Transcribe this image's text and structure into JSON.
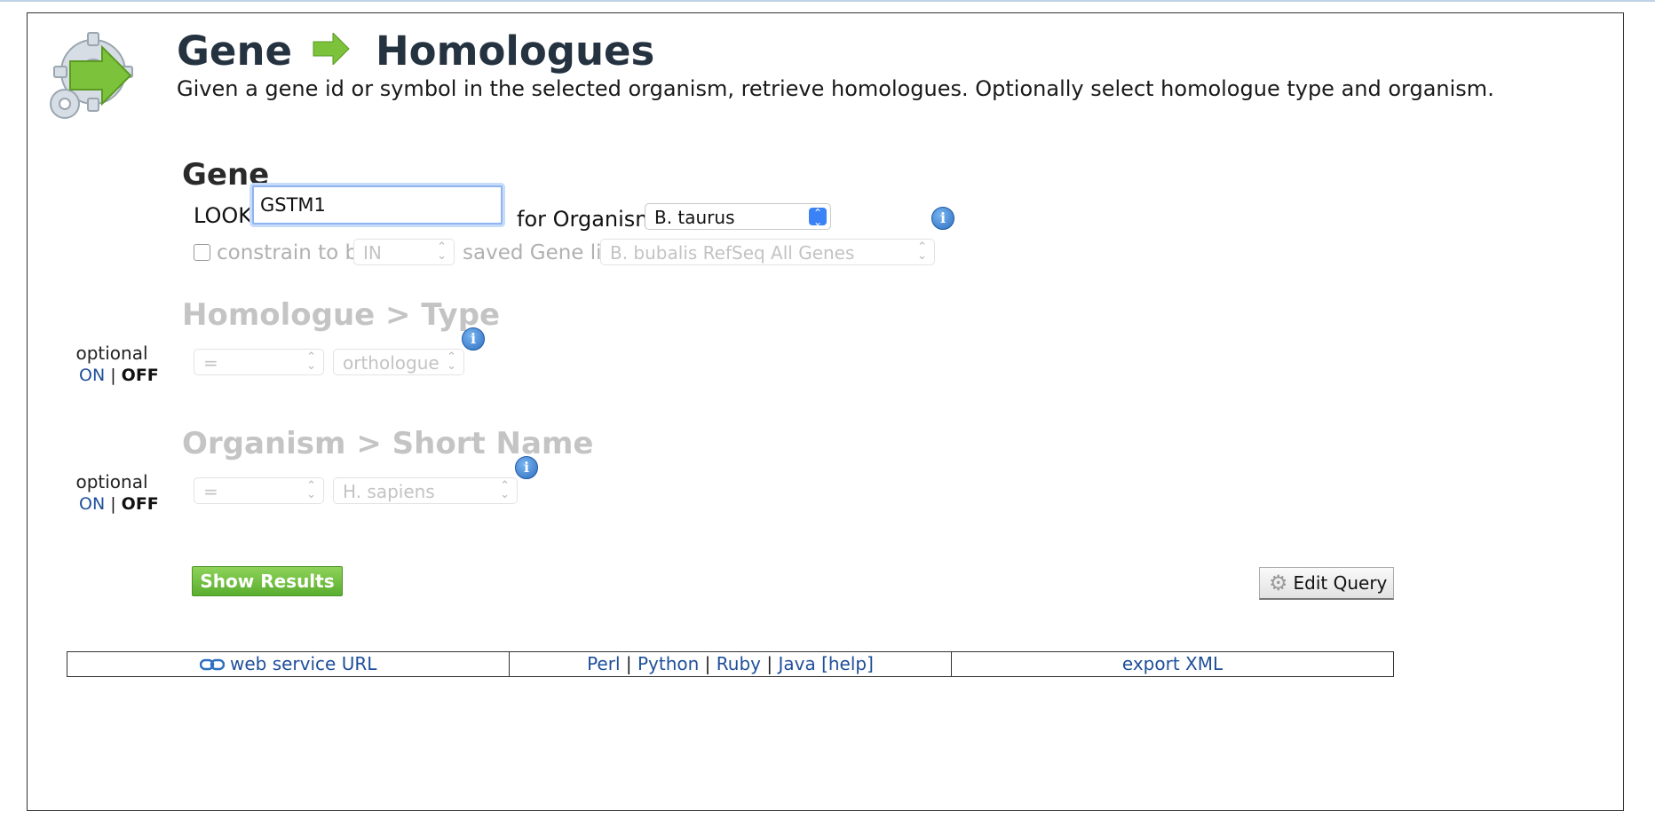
{
  "header": {
    "title_left": "Gene",
    "title_right": "Homologues",
    "description": "Given a gene id or symbol in the selected organism, retrieve homologues. Optionally select homologue type and organism."
  },
  "gene": {
    "section_title": "Gene",
    "lookup_label": "LOOKUP:",
    "lookup_value": "GSTM1",
    "for_organism_label": "for Organism:",
    "organism_value": "B. taurus",
    "constrain_label": "constrain to be",
    "constrain_op": "IN",
    "saved_label": "saved Gene list",
    "saved_list": "B. bubalis RefSeq All Genes"
  },
  "homologue_type": {
    "section_title": "Homologue > Type",
    "optional_label": "optional",
    "on_label": "ON",
    "off_label": "OFF",
    "operator": "=",
    "value": "orthologue"
  },
  "organism_short": {
    "section_title": "Organism > Short Name",
    "optional_label": "optional",
    "on_label": "ON",
    "off_label": "OFF",
    "operator": "=",
    "value": "H. sapiens"
  },
  "actions": {
    "show_results": "Show Results",
    "edit_query": "Edit Query"
  },
  "footer": {
    "web_service": "web service URL",
    "perl": "Perl",
    "python": "Python",
    "ruby": "Ruby",
    "java": "Java",
    "help": "[help]",
    "export_xml": "export XML",
    "separator": "|"
  },
  "icons": {
    "info": "i",
    "select_chevron": "⌃⌄",
    "link": "link-icon"
  },
  "colors": {
    "accent_blue": "#1f4f9a",
    "green_button": "#5aae2f",
    "disabled_text": "#c4c4c4"
  }
}
